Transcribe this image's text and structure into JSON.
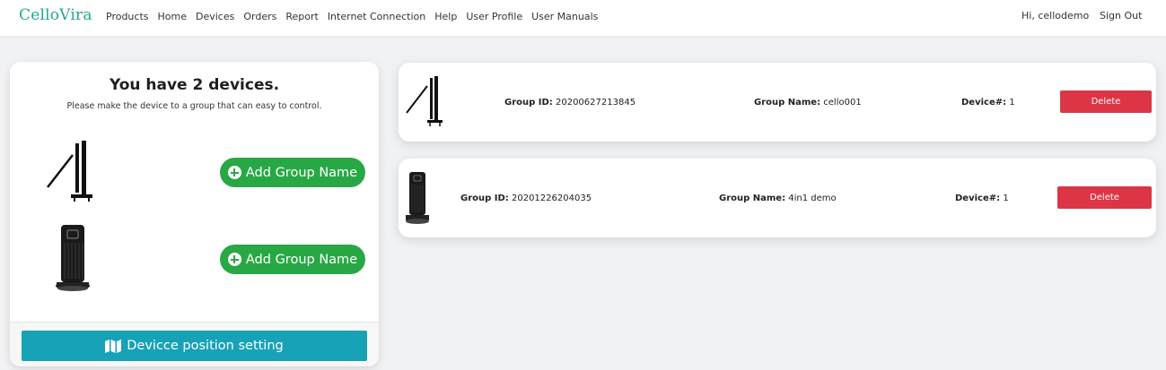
{
  "brand": "CelloVira",
  "nav": {
    "items": [
      "Products",
      "Home",
      "Devices",
      "Orders",
      "Report",
      "Internet Connection",
      "Help",
      "User Profile",
      "User Manuals"
    ],
    "greeting": "Hi, cellodemo",
    "signout": "Sign Out"
  },
  "left_panel": {
    "title": "You have 2 devices.",
    "subtitle": "Please make the device to a group that can easy to control.",
    "add_group_label": "Add Group Name",
    "position_button": "Devicce position setting"
  },
  "groups": [
    {
      "id_label": "Group ID:",
      "id": "20200627213845",
      "name_label": "Group Name:",
      "name": "cello001",
      "count_label": "Device#:",
      "count": "1",
      "delete": "Delete"
    },
    {
      "id_label": "Group ID:",
      "id": "20201226204035",
      "name_label": "Group Name:",
      "name": "4in1 demo",
      "count_label": "Device#:",
      "count": "1",
      "delete": "Delete"
    }
  ],
  "colors": {
    "brand": "#20a88b",
    "add_button": "#28a745",
    "position_button": "#17a2b8",
    "delete_button": "#dc3545"
  },
  "icons": [
    "plus-circle-icon",
    "map-icon",
    "stand-device-icon",
    "tower-device-icon"
  ]
}
